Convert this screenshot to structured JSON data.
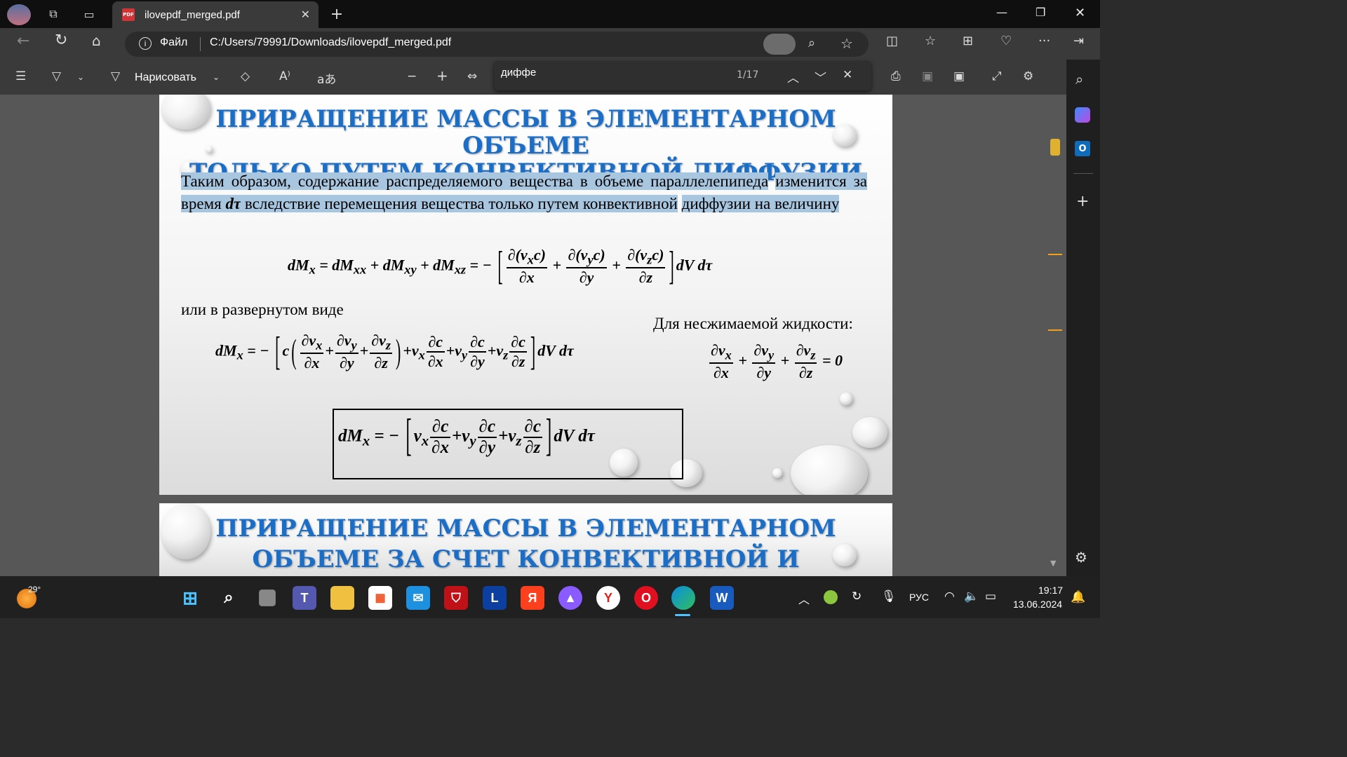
{
  "browser": {
    "tab_title": "ilovepdf_merged.pdf",
    "file_label": "Файл",
    "url": "C:/Users/79991/Downloads/ilovepdf_merged.pdf"
  },
  "pdf_toolbar": {
    "draw_label": "Нарисовать",
    "read_aloud_label": "A⁾",
    "find_query": "диффе",
    "find_count": "1/17"
  },
  "slide1": {
    "title_line1": "ПРИРАЩЕНИЕ МАССЫ В ЭЛЕМЕНТАРНОМ ОБЪЕМЕ",
    "title_line2": "ТОЛЬКО ПУТЕМ КОНВЕКТИВНОЙ ДИФФУЗИИ",
    "paragraph_line1": "Таким образом, содержание распределяемого вещества в объеме параллелепипеда",
    "paragraph_line2a": "изменится за время ",
    "paragraph_dt": "dτ",
    "paragraph_line2b": " вследствие перемещения вещества только путем конвективной",
    "paragraph_line3": "диффузии на величину",
    "expanded_label": "или в развернутом виде",
    "incompressible_label": "Для несжимаемой жидкости:"
  },
  "slide2": {
    "title_line1": "ПРИРАЩЕНИЕ МАССЫ В ЭЛЕМЕНТАРНОМ",
    "title_line2": "ОБЪЕМЕ ЗА СЧЕТ КОНВЕКТИВНОЙ И"
  },
  "taskbar": {
    "weather_temp": "29°",
    "language": "РУС",
    "time": "19:17",
    "date": "13.06.2024"
  },
  "colors": {
    "title_blue": "#1a6ec8",
    "highlight": "#a9c6e0",
    "scroll_marker": "#f0a020"
  },
  "icons": [
    "profile-icon",
    "workspaces-icon",
    "tab-actions-icon",
    "pdf-icon",
    "close-icon",
    "new-tab-icon",
    "minimize-icon",
    "restore-icon",
    "back-icon",
    "refresh-icon",
    "home-icon",
    "info-icon",
    "immersive-reader-icon",
    "zoom-icon",
    "favorite-star-icon",
    "split-screen-icon",
    "favorites-icon",
    "collections-icon",
    "health-icon",
    "more-icon",
    "sidebar-toggle-icon",
    "table-of-contents-icon",
    "highlight-icon",
    "draw-icon",
    "eraser-icon",
    "translate-icon",
    "fit-page-icon",
    "print-icon",
    "save-icon",
    "save-as-icon",
    "fullscreen-icon",
    "settings-icon",
    "search-icon",
    "copilot-icon",
    "outlook-icon",
    "add-icon",
    "weather-icon",
    "windows-icon",
    "task-view-icon",
    "teams-icon",
    "explorer-icon",
    "store-icon",
    "mail-icon",
    "antivirus-icon",
    "yandex-browser-icon",
    "alice-icon",
    "opera-icon",
    "edge-icon",
    "word-icon",
    "wifi-icon",
    "volume-icon",
    "battery-icon",
    "microphone-icon",
    "notification-icon"
  ]
}
